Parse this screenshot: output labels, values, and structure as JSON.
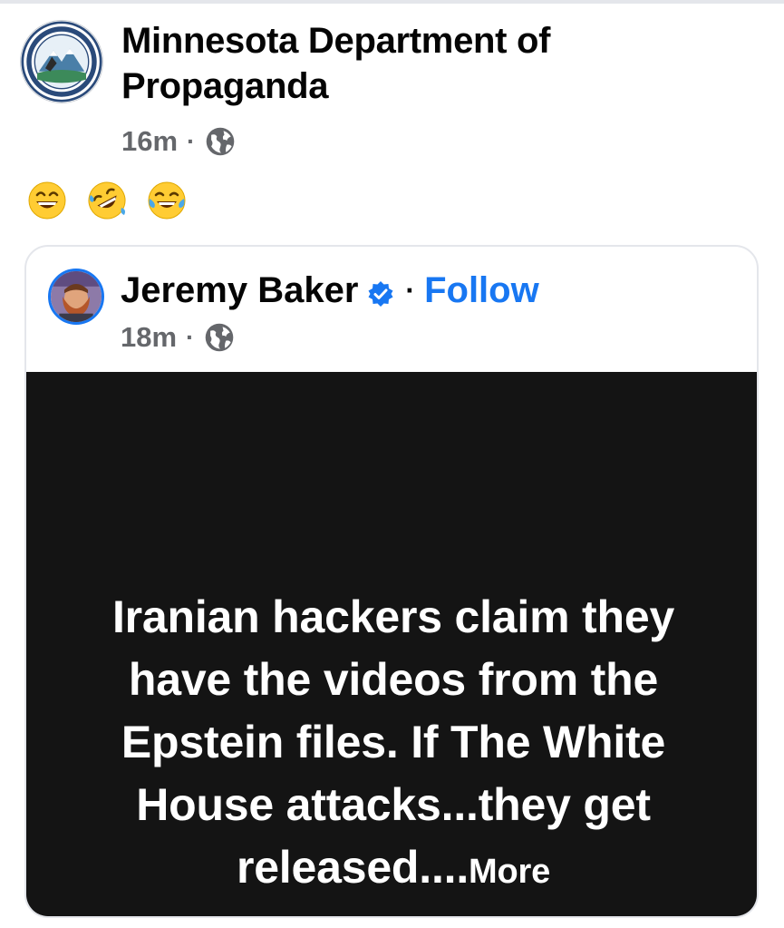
{
  "post": {
    "author": "Minnesota Department of Propaganda",
    "time": "16m",
    "separator": "·",
    "audience_icon": "globe-icon",
    "emojis": [
      "grinning-face-icon",
      "rofl-icon",
      "tears-of-joy-icon"
    ]
  },
  "shared": {
    "author": "Jeremy Baker",
    "verified_icon": "verified-badge-icon",
    "separator": "·",
    "follow_label": "Follow",
    "time": "18m",
    "audience_icon": "globe-icon",
    "text": "Iranian hackers claim they have the videos from the Epstein files. If The White House attacks...they get released....",
    "more_label": "More",
    "image_background": "#141414"
  },
  "colors": {
    "link_blue": "#1877f2",
    "meta_gray": "#65676b",
    "text_dark": "#050505"
  }
}
